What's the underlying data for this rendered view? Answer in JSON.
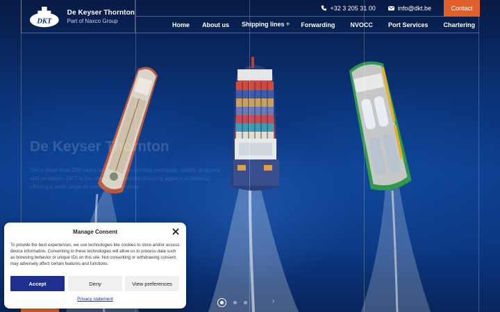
{
  "brand": {
    "logo_text": "DKT",
    "name": "De Keyser Thornton",
    "subtitle": "Part of Naxco Group"
  },
  "topbar": {
    "phone": "+32 3 205 31 00",
    "email": "info@dkt.be",
    "contact_label": "Contact"
  },
  "nav": {
    "items": [
      "Home",
      "About us",
      "Shipping lines",
      "Forwarding",
      "NVOCC",
      "Port Services",
      "Chartering"
    ],
    "expand_symbol": "+"
  },
  "hero": {
    "title": "De Keyser Thornton",
    "text": "Since more than 200 years we have been serving principals, clients, shippers and receivers. DKT is the oldest independent shipping agency in Antwerp, offering a wide range of specialised services."
  },
  "slider": {
    "next_symbol": "›"
  },
  "cookie": {
    "title": "Manage Consent",
    "text": "To provide the best experiences, we use technologies like cookies to store and/or access device information. Consenting to these technologies will allow us to process data such as browsing behavior or unique IDs on this site. Not consenting or withdrawing consent, may adversely affect certain features and functions.",
    "accept": "Accept",
    "deny": "Deny",
    "preferences": "View preferences",
    "privacy": "Privacy statement"
  },
  "colors": {
    "accent": "#e2612b",
    "accept_button": "#1e2f8f",
    "ocean": "#0d3f8f"
  }
}
